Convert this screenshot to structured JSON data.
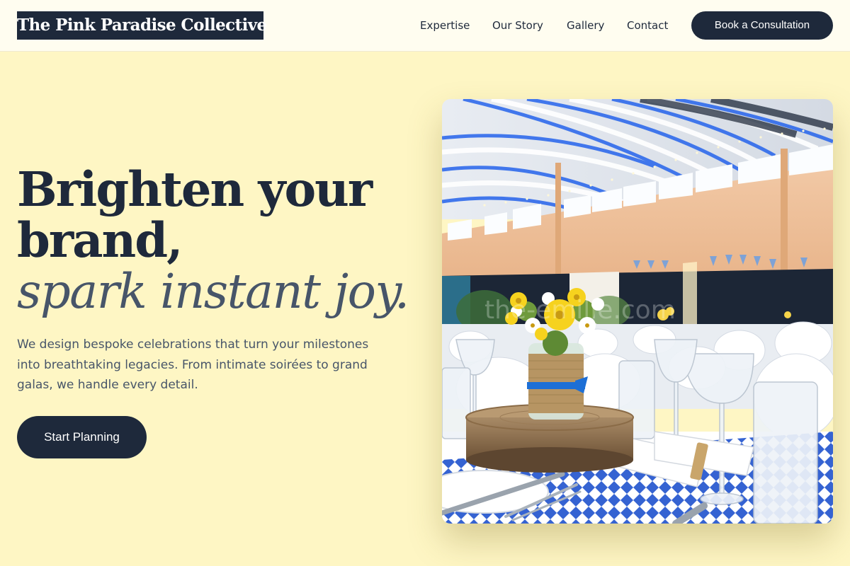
{
  "brand": {
    "name": "The Pink Paradise Collective"
  },
  "nav": {
    "links": [
      "Expertise",
      "Our Story",
      "Gallery",
      "Contact"
    ],
    "cta_label": "Book a Consultation"
  },
  "hero": {
    "headline_line1": "Brighten your brand,",
    "headline_accent": "spark instant joy.",
    "lead": "We design bespoke celebrations that turn your milestones into breathtaking legacies. From intimate soirées to grand galas, we handle every detail.",
    "cta_label": "Start Planning"
  },
  "image": {
    "semantic": "banquet-hall-table-setting-photo",
    "watermark": "the-emilie.com"
  },
  "colors": {
    "page_background": "#fef6c4",
    "header_background": "#fffdf0",
    "navy": "#1e293b",
    "slate": "#475569"
  }
}
